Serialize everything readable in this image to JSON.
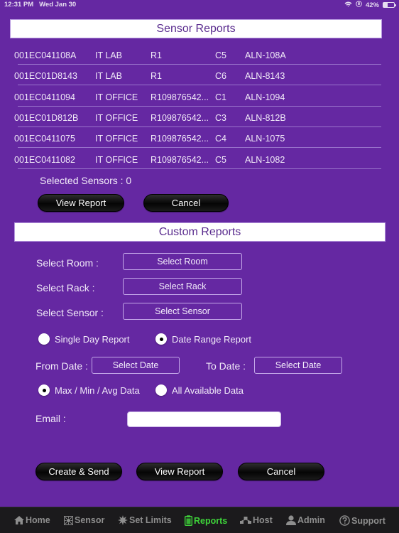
{
  "status_bar": {
    "time": "12:31 PM",
    "date": "Wed Jan 30",
    "battery_percent": "42%",
    "battery_level": 0.42
  },
  "sensor_reports": {
    "title": "Sensor Reports",
    "rows": [
      {
        "id": "001EC041108A",
        "room": "IT LAB",
        "rack": "R1",
        "position": "C5",
        "name": "ALN-108A"
      },
      {
        "id": "001EC01D8143",
        "room": "IT LAB",
        "rack": "R1",
        "position": "C6",
        "name": "ALN-8143"
      },
      {
        "id": "001EC0411094",
        "room": "IT OFFICE",
        "rack": "R109876542...",
        "position": "C1",
        "name": "ALN-1094"
      },
      {
        "id": "001EC01D812B",
        "room": "IT OFFICE",
        "rack": "R109876542...",
        "position": "C3",
        "name": "ALN-812B"
      },
      {
        "id": "001EC0411075",
        "room": "IT OFFICE",
        "rack": "R109876542...",
        "position": "C4",
        "name": "ALN-1075"
      },
      {
        "id": "001EC0411082",
        "room": "IT OFFICE",
        "rack": "R109876542...",
        "position": "C5",
        "name": "ALN-1082"
      }
    ],
    "selected_label": "Selected Sensors : 0",
    "view_report_label": "View Report",
    "cancel_label": "Cancel"
  },
  "custom_reports": {
    "title": "Custom Reports",
    "room_label": "Select Room :",
    "room_button": "Select Room",
    "rack_label": "Select Rack :",
    "rack_button": "Select Rack",
    "sensor_label": "Select Sensor :",
    "sensor_button": "Select Sensor",
    "report_type": {
      "options": [
        "Single Day Report",
        "Date Range Report"
      ],
      "selected": "Date Range Report"
    },
    "from_date_label": "From Date :",
    "from_date_button": "Select Date",
    "to_date_label": "To Date :",
    "to_date_button": "Select Date",
    "data_type": {
      "options": [
        "Max / Min / Avg Data",
        "All Available Data"
      ],
      "selected": "Max / Min / Avg Data"
    },
    "email_label": "Email :",
    "email_value": "",
    "email_placeholder": "",
    "create_send_label": "Create & Send",
    "view_report_label": "View Report",
    "cancel_label": "Cancel"
  },
  "tab_bar": {
    "active": "Reports",
    "active_color": "#3ed43a",
    "items": [
      {
        "label": "Home",
        "icon": "home-icon"
      },
      {
        "label": "Sensor",
        "icon": "sensor-icon"
      },
      {
        "label": "Set Limits",
        "icon": "set-limits-icon"
      },
      {
        "label": "Reports",
        "icon": "reports-icon"
      },
      {
        "label": "Host",
        "icon": "host-icon"
      },
      {
        "label": "Admin",
        "icon": "admin-icon"
      },
      {
        "label": "Support",
        "icon": "support-icon"
      }
    ]
  },
  "colors": {
    "background": "#6528a2",
    "header_text": "#5b2d8f",
    "tab_bar": "#1b1a1c"
  }
}
